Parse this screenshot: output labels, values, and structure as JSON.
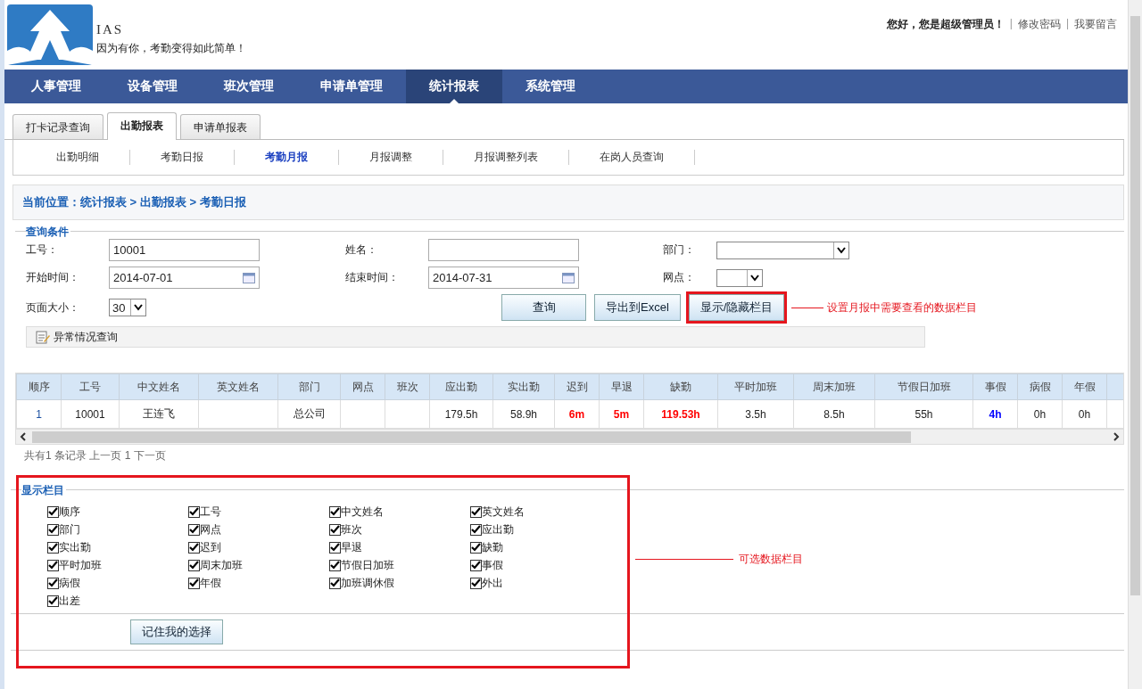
{
  "header": {
    "brand": "IAS",
    "tagline": "因为有你，考勤变得如此简单！",
    "greeting": "您好，您是超级管理员！",
    "links": [
      {
        "separator": "|",
        "label": "修改密码"
      },
      {
        "separator": "|",
        "label": "我要留言"
      }
    ]
  },
  "nav": [
    {
      "label": "人事管理",
      "selected": false
    },
    {
      "label": "设备管理",
      "selected": false
    },
    {
      "label": "班次管理",
      "selected": false
    },
    {
      "label": "申请单管理",
      "selected": false
    },
    {
      "label": "统计报表",
      "selected": true
    },
    {
      "label": "系统管理",
      "selected": false
    }
  ],
  "tabs": [
    {
      "label": "打卡记录查询",
      "selected": false
    },
    {
      "label": "出勤报表",
      "selected": true
    },
    {
      "label": "申请单报表",
      "selected": false
    }
  ],
  "subnav": [
    {
      "label": "出勤明细",
      "selected": false
    },
    {
      "label": "考勤日报",
      "selected": false
    },
    {
      "label": "考勤月报",
      "selected": true
    },
    {
      "label": "月报调整",
      "selected": false
    },
    {
      "label": "月报调整列表",
      "selected": false
    },
    {
      "label": "在岗人员查询",
      "selected": false
    }
  ],
  "breadcrumb": "当前位置：统计报表 > 出勤报表 > 考勤日报",
  "query": {
    "legend": "查询条件",
    "fields": [
      {
        "label": "工号：",
        "kind": "text",
        "value": "10001"
      },
      {
        "label": "姓名：",
        "kind": "text"
      },
      {
        "label": "部门：",
        "kind": "select"
      },
      {
        "label": "开始时间：",
        "kind": "date",
        "value": "2014-07-01"
      },
      {
        "label": "结束时间：",
        "kind": "date",
        "value": "2014-07-31"
      },
      {
        "label": "网点：",
        "kind": "select"
      }
    ],
    "page_size": {
      "label": "页面大小：",
      "value": "30"
    },
    "buttons": [
      {
        "label": "查询",
        "highlighted": false
      },
      {
        "label": "导出到Excel",
        "highlighted": false
      },
      {
        "label": "显示/隐藏栏目",
        "highlighted": true
      }
    ],
    "annotation": "设置月报中需要查看的数据栏目",
    "exception_link": "异常情况查询"
  },
  "table": {
    "columns": [
      "顺序",
      "工号",
      "中文姓名",
      "英文姓名",
      "部门",
      "网点",
      "班次",
      "应出勤",
      "实出勤",
      "迟到",
      "早退",
      "缺勤",
      "平时加班",
      "周末加班",
      "节假日加班",
      "事假",
      "病假",
      "年假"
    ],
    "rows": [
      [
        {
          "text": "1",
          "color": "#1a4fa0"
        },
        {
          "text": "10001"
        },
        {
          "text": "王连飞"
        },
        {
          "text": ""
        },
        {
          "text": "总公司"
        },
        {
          "text": ""
        },
        {
          "text": ""
        },
        {
          "text": "179.5h"
        },
        {
          "text": "58.9h"
        },
        {
          "text": "6m",
          "color": "#ff0000"
        },
        {
          "text": "5m",
          "color": "#ff0000"
        },
        {
          "text": "119.53h",
          "color": "#ff0000"
        },
        {
          "text": "3.5h"
        },
        {
          "text": "8.5h"
        },
        {
          "text": "55h"
        },
        {
          "text": "4h",
          "color": "#0000ff"
        },
        {
          "text": "0h"
        },
        {
          "text": "0h"
        }
      ]
    ]
  },
  "pager": "共有1 条记录 上一页 1 下一页",
  "columns_panel": {
    "legend": "显示栏目",
    "options": [
      {
        "label": "顺序",
        "checked": true
      },
      {
        "label": "工号",
        "checked": true
      },
      {
        "label": "中文姓名",
        "checked": true
      },
      {
        "label": "英文姓名",
        "checked": true
      },
      {
        "label": "部门",
        "checked": true
      },
      {
        "label": "网点",
        "checked": true
      },
      {
        "label": "班次",
        "checked": true
      },
      {
        "label": "应出勤",
        "checked": true
      },
      {
        "label": "实出勤",
        "checked": true
      },
      {
        "label": "迟到",
        "checked": true
      },
      {
        "label": "早退",
        "checked": true
      },
      {
        "label": "缺勤",
        "checked": true
      },
      {
        "label": "平时加班",
        "checked": true
      },
      {
        "label": "周末加班",
        "checked": true
      },
      {
        "label": "节假日加班",
        "checked": true
      },
      {
        "label": "事假",
        "checked": true
      },
      {
        "label": "病假",
        "checked": true
      },
      {
        "label": "年假",
        "checked": true
      },
      {
        "label": "加班调休假",
        "checked": true
      },
      {
        "label": "外出",
        "checked": true
      },
      {
        "label": "出差",
        "checked": true
      }
    ],
    "save_button": "记住我的选择",
    "annotation": "可选数据栏目"
  }
}
